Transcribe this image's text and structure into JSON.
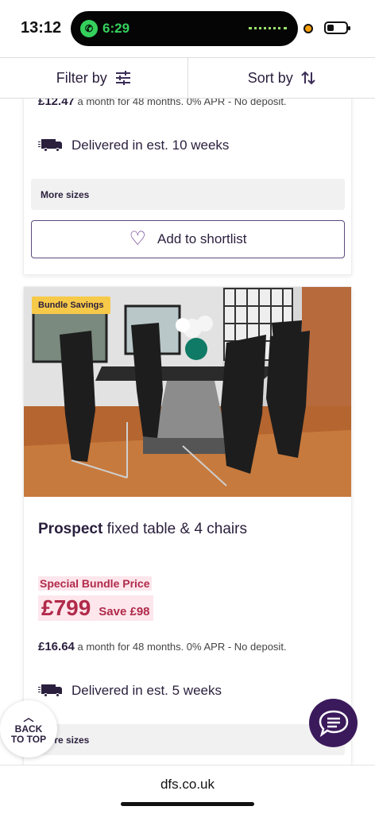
{
  "status_bar": {
    "time": "13:12",
    "call_timer": "6:29"
  },
  "filter_bar": {
    "filter_label": "Filter by",
    "sort_label": "Sort by"
  },
  "card1": {
    "finance_amount": "£12.47",
    "finance_text": "a month for 48 months. 0% APR - No deposit.",
    "delivery": "Delivered in est. 10 weeks",
    "sizes_label": "More sizes",
    "shortlist_label": "Add to shortlist"
  },
  "card2": {
    "badge": "Bundle Savings",
    "title_brand": "Prospect",
    "title_rest": "fixed table & 4 chairs",
    "special_label": "Special Bundle Price",
    "price": "£799",
    "save": "Save £98",
    "finance_amount": "£16.64",
    "finance_text": "a month for 48 months. 0% APR - No deposit.",
    "delivery": "Delivered in est. 5 weeks",
    "sizes_label": "More sizes"
  },
  "back_to_top": {
    "line1": "BACK",
    "line2": "TO TOP"
  },
  "browser": {
    "url": "dfs.co.uk"
  },
  "colors": {
    "brand_purple": "#3b1a5c",
    "price_red": "#b12a4a",
    "badge_yellow": "#f7c948"
  }
}
